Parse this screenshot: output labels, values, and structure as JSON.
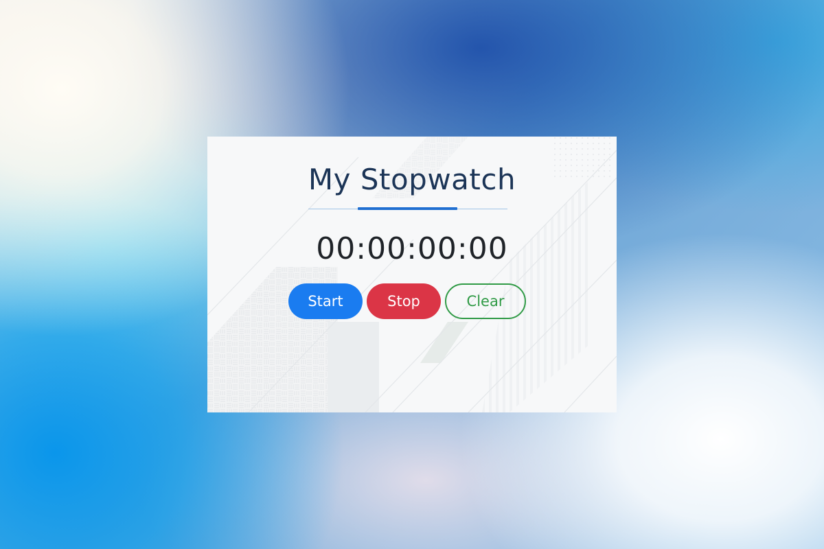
{
  "app": {
    "title": "My Stopwatch"
  },
  "timer": {
    "display": "00:00:00:00"
  },
  "controls": {
    "start_label": "Start",
    "stop_label": "Stop",
    "clear_label": "Clear"
  },
  "colors": {
    "title": "#1c3557",
    "accent_underline": "#1f6fd1",
    "start": "#1a7cf0",
    "stop": "#db3546",
    "clear": "#2f9a45"
  }
}
